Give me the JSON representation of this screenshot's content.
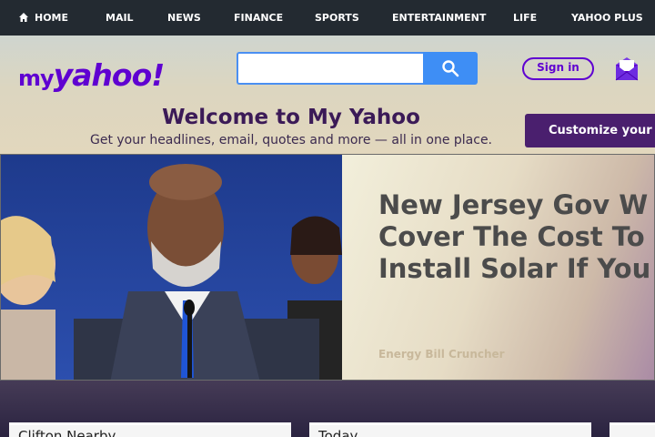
{
  "nav": {
    "items": [
      {
        "label": "HOME",
        "icon": "home-icon"
      },
      {
        "label": "MAIL"
      },
      {
        "label": "NEWS"
      },
      {
        "label": "FINANCE"
      },
      {
        "label": "SPORTS"
      },
      {
        "label": "ENTERTAINMENT"
      },
      {
        "label": "LIFE"
      },
      {
        "label": "YAHOO PLUS"
      }
    ]
  },
  "header": {
    "logo_my": "my",
    "logo_yahoo": "yahoo!",
    "search_value": "",
    "signin_label": "Sign in",
    "welcome_title": "Welcome to My Yahoo",
    "welcome_sub": "Get your headlines, email, quotes and more — all in one place.",
    "customize_label": "Customize your"
  },
  "hero": {
    "headline_lines": [
      "New Jersey Gov W",
      "Cover The Cost To",
      "Install Solar If You"
    ],
    "source": "Energy Bill Cruncher"
  },
  "cards": [
    {
      "label": "Clifton Nearby"
    },
    {
      "label": "Today"
    },
    {
      "label": ""
    }
  ],
  "colors": {
    "brand_purple": "#5f01d1",
    "nav_bg": "#232a31",
    "search_blue": "#3e8ef5",
    "customize_bg": "#4a1f6e"
  }
}
